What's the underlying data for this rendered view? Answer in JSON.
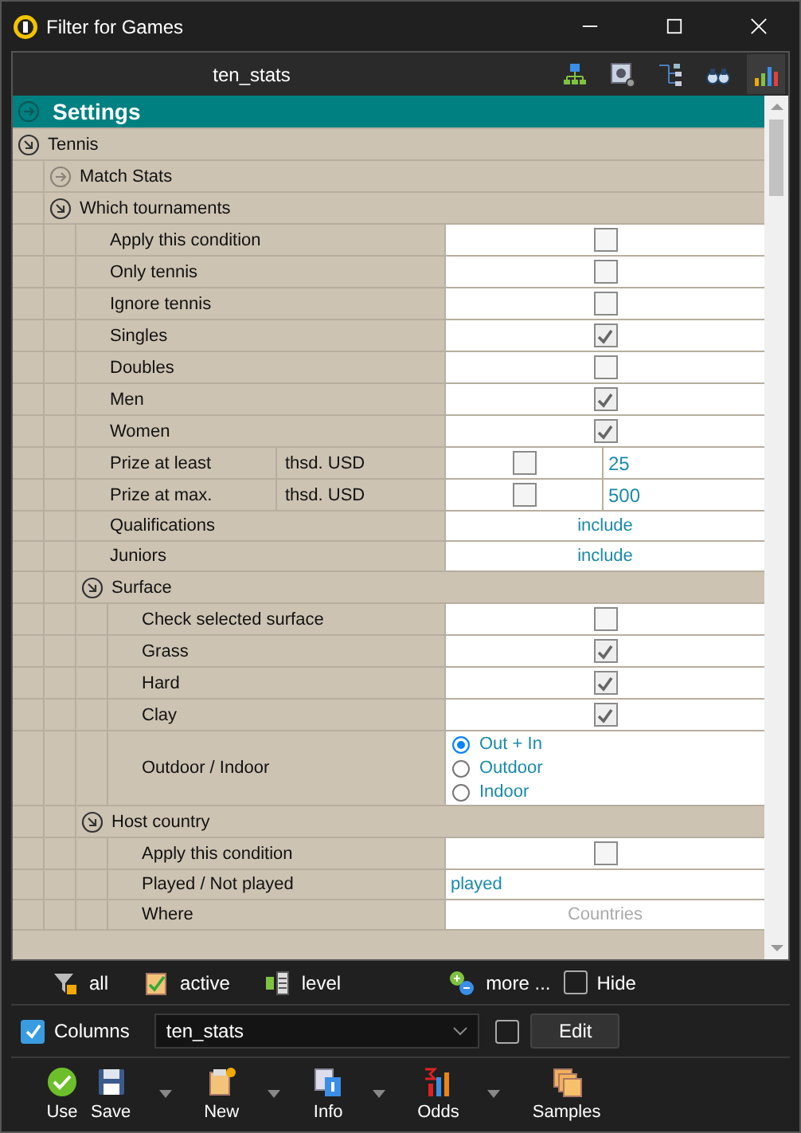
{
  "window": {
    "title": "Filter for Games"
  },
  "toolbar": {
    "title": "ten_stats",
    "buttons": [
      {
        "selected": false
      },
      {
        "selected": false
      },
      {
        "selected": false
      },
      {
        "selected": false
      },
      {
        "selected": true
      }
    ]
  },
  "tree": {
    "header": "Settings",
    "items": [
      {
        "kind": "group",
        "label": "Tennis",
        "expanded": true,
        "children": [
          {
            "kind": "group",
            "label": "Match Stats",
            "expanded": false
          },
          {
            "kind": "group",
            "label": "Which tournaments",
            "expanded": true,
            "children": [
              {
                "kind": "check",
                "label": "Apply this condition",
                "checked": false
              },
              {
                "kind": "check",
                "label": "Only tennis",
                "checked": false
              },
              {
                "kind": "check",
                "label": "Ignore tennis",
                "checked": false
              },
              {
                "kind": "check",
                "label": "Singles",
                "checked": true
              },
              {
                "kind": "check",
                "label": "Doubles",
                "checked": false
              },
              {
                "kind": "check",
                "label": "Men",
                "checked": true
              },
              {
                "kind": "check",
                "label": "Women",
                "checked": true
              },
              {
                "kind": "range",
                "label": "Prize at least",
                "unit": "thsd. USD",
                "checked": false,
                "value": "25"
              },
              {
                "kind": "range",
                "label": "Prize at max.",
                "unit": "thsd. USD",
                "checked": false,
                "value": "500"
              },
              {
                "kind": "choice",
                "label": "Qualifications",
                "value": "include"
              },
              {
                "kind": "choice",
                "label": "Juniors",
                "value": "include"
              },
              {
                "kind": "group",
                "label": "Surface",
                "expanded": true,
                "children": [
                  {
                    "kind": "check",
                    "label": "Check selected surface",
                    "checked": false
                  },
                  {
                    "kind": "check",
                    "label": "Grass",
                    "checked": true
                  },
                  {
                    "kind": "check",
                    "label": "Hard",
                    "checked": true
                  },
                  {
                    "kind": "check",
                    "label": "Clay",
                    "checked": true
                  },
                  {
                    "kind": "radio",
                    "label": "Outdoor / Indoor",
                    "options": [
                      {
                        "label": "Out + In",
                        "selected": true
                      },
                      {
                        "label": "Outdoor",
                        "selected": false
                      },
                      {
                        "label": "Indoor",
                        "selected": false
                      }
                    ]
                  }
                ]
              },
              {
                "kind": "group",
                "label": "Host country",
                "expanded": true,
                "children": [
                  {
                    "kind": "check",
                    "label": "Apply this condition",
                    "checked": false
                  },
                  {
                    "kind": "text",
                    "label": "Played / Not played",
                    "value": "played"
                  },
                  {
                    "kind": "picker",
                    "label": "Where",
                    "placeholder": "Countries"
                  }
                ]
              }
            ]
          }
        ]
      }
    ]
  },
  "filter_bar": {
    "items": [
      {
        "label": "all"
      },
      {
        "label": "active"
      },
      {
        "label": "level"
      },
      {
        "label": "more ..."
      }
    ],
    "hide": {
      "label": "Hide",
      "checked": false
    }
  },
  "columns_bar": {
    "columns": {
      "label": "Columns",
      "checked": true
    },
    "select": {
      "value": "ten_stats"
    },
    "option": {
      "checked": false
    },
    "edit": "Edit"
  },
  "actions": [
    {
      "label": "Use",
      "dropdown": false
    },
    {
      "label": "Save",
      "dropdown": true
    },
    {
      "label": "New",
      "dropdown": true
    },
    {
      "label": "Info",
      "dropdown": true
    },
    {
      "label": "Odds",
      "dropdown": true
    },
    {
      "label": "Samples",
      "dropdown": false
    }
  ]
}
